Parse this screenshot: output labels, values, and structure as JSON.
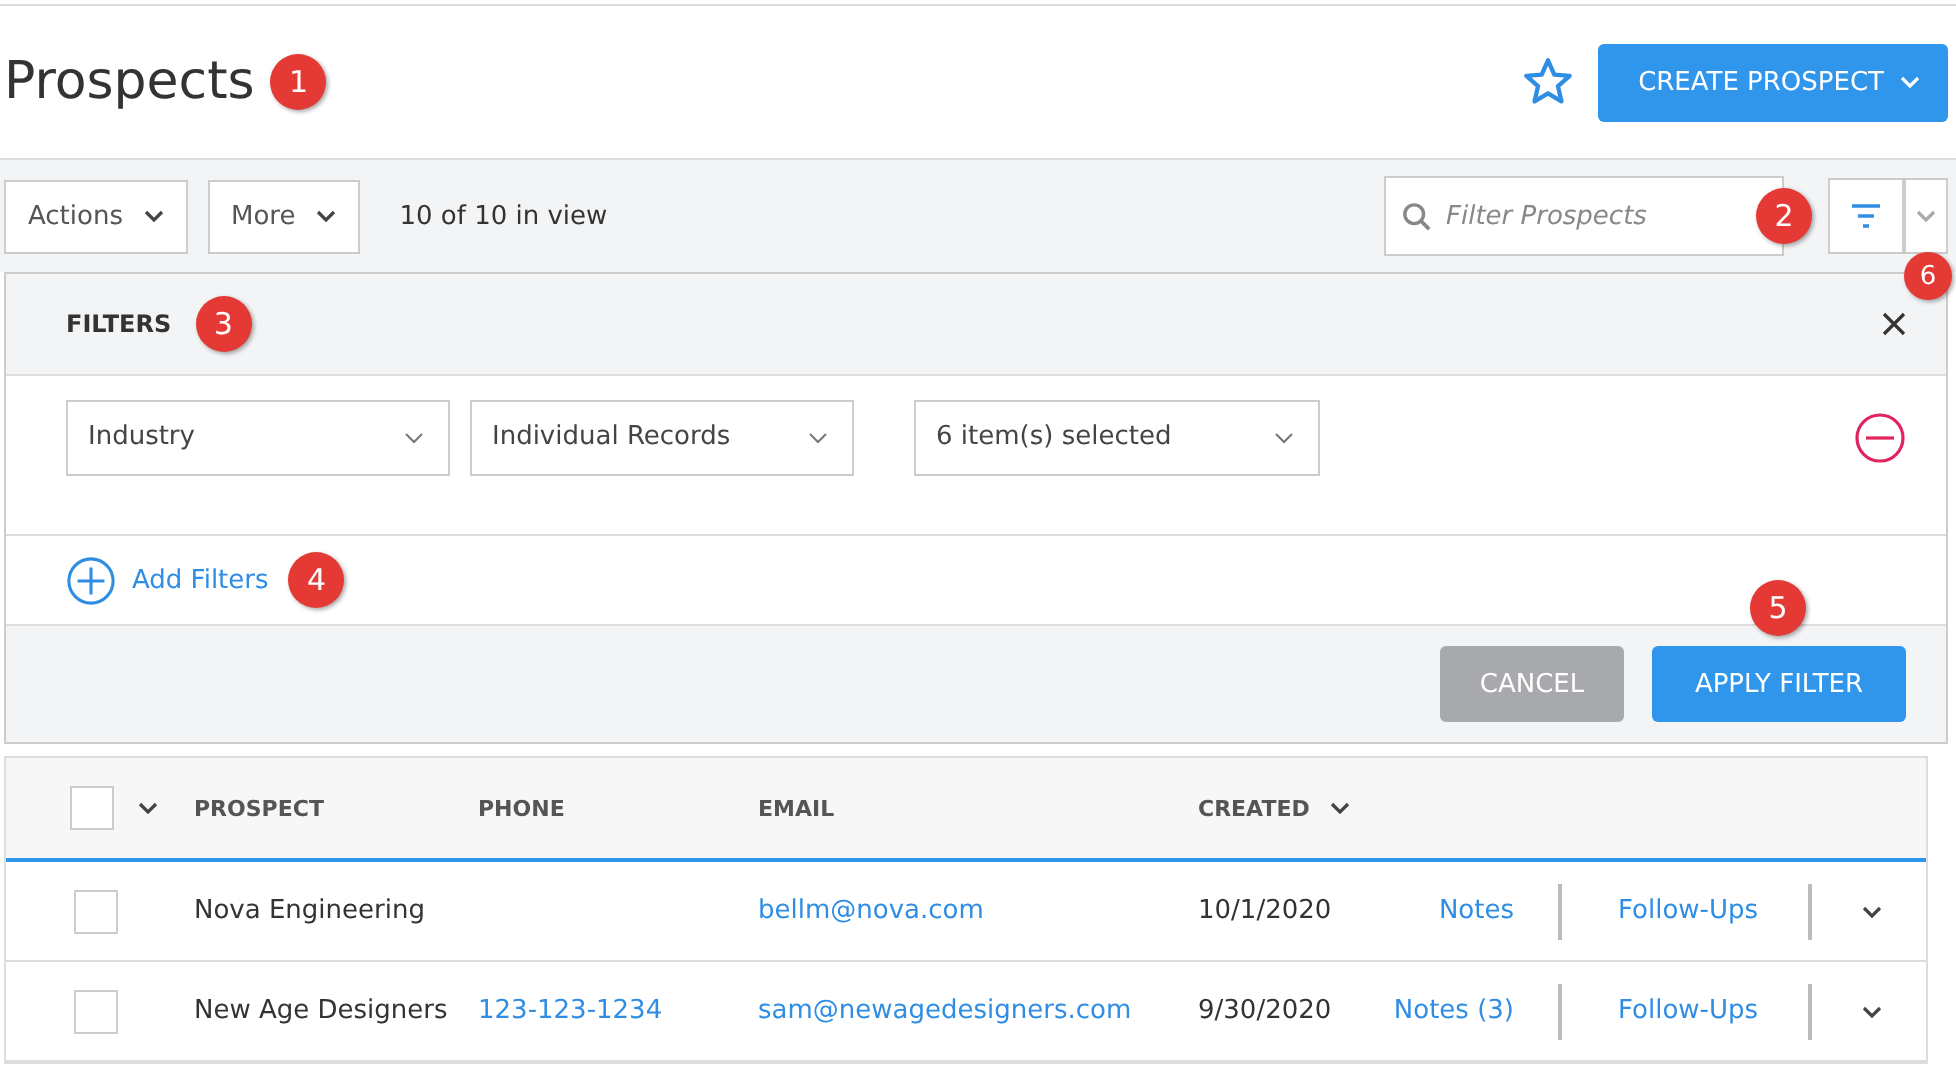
{
  "page": {
    "title": "Prospects",
    "favorite": false,
    "create_button": "CREATE PROSPECT"
  },
  "toolbar": {
    "actions": "Actions",
    "more": "More",
    "view_count": "10 of 10 in view",
    "search": {
      "placeholder": "Filter Prospects"
    }
  },
  "filters": {
    "title": "FILTERS",
    "rows": [
      {
        "field": "Industry",
        "mode": "Individual Records",
        "value": "6 item(s) selected"
      }
    ],
    "add": "Add Filters",
    "cancel": "CANCEL",
    "apply": "APPLY FILTER"
  },
  "callouts": [
    "1",
    "2",
    "3",
    "4",
    "5",
    "6"
  ],
  "table": {
    "all_checked": false,
    "columns": [
      "PROSPECT",
      "PHONE",
      "EMAIL",
      "CREATED"
    ],
    "rows": [
      {
        "checked": false,
        "prospect": "Nova Engineering",
        "phone": "",
        "email": "bellm@nova.com",
        "created": "10/1/2020",
        "notes": "Notes",
        "followups": "Follow-Ups"
      },
      {
        "checked": false,
        "prospect": "New Age Designers",
        "phone": "123-123-1234",
        "email": "sam@newagedesigners.com",
        "created": "9/30/2020",
        "notes": "Notes (3)",
        "followups": "Follow-Ups"
      }
    ]
  }
}
